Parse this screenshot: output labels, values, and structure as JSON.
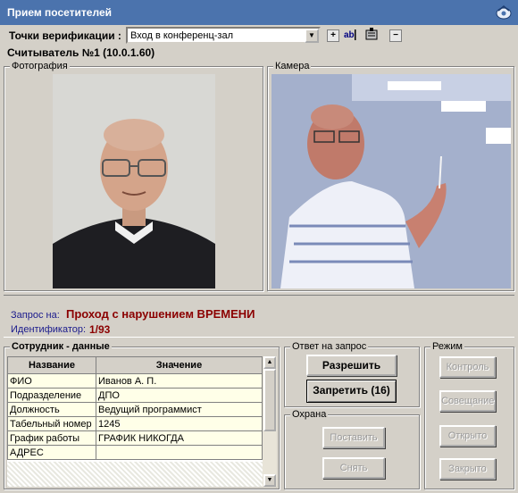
{
  "window": {
    "title": "Прием посетителей"
  },
  "toolbar": {
    "label": "Точки верификации :",
    "selected_point": "Вход в конференц-зал"
  },
  "reader": {
    "title": "Считыватель №1 (10.0.1.60)"
  },
  "photo": {
    "label": "Фотография"
  },
  "camera": {
    "label": "Камера"
  },
  "request": {
    "label": "Запрос на:",
    "value": "Проход с нарушением ВРЕМЕНИ",
    "id_label": "Идентификатор:",
    "id_value": "1/93"
  },
  "employee": {
    "title": "Сотрудник - данные",
    "col_name": "Название",
    "col_value": "Значение",
    "rows": [
      {
        "name": "ФИО",
        "value": "Иванов А. П."
      },
      {
        "name": "Подразделение",
        "value": "ДПО"
      },
      {
        "name": "Должность",
        "value": "Ведущий программист"
      },
      {
        "name": "Табельный номер",
        "value": "1245"
      },
      {
        "name": "График работы",
        "value": "ГРАФИК НИКОГДА"
      },
      {
        "name": "АДРЕС",
        "value": ""
      }
    ]
  },
  "answer": {
    "title": "Ответ на запрос",
    "allow": "Разрешить",
    "deny": "Запретить (16)"
  },
  "guard": {
    "title": "Охрана",
    "arm": "Поставить",
    "disarm": "Снять"
  },
  "mode": {
    "title": "Режим",
    "control": "Контроль",
    "meeting": "Совещание",
    "open": "Открыто",
    "closed": "Закрыто"
  },
  "colors": {
    "title_bar": "#4b73ad",
    "request_value": "#8b0000",
    "request_label": "#1a1a8c"
  }
}
